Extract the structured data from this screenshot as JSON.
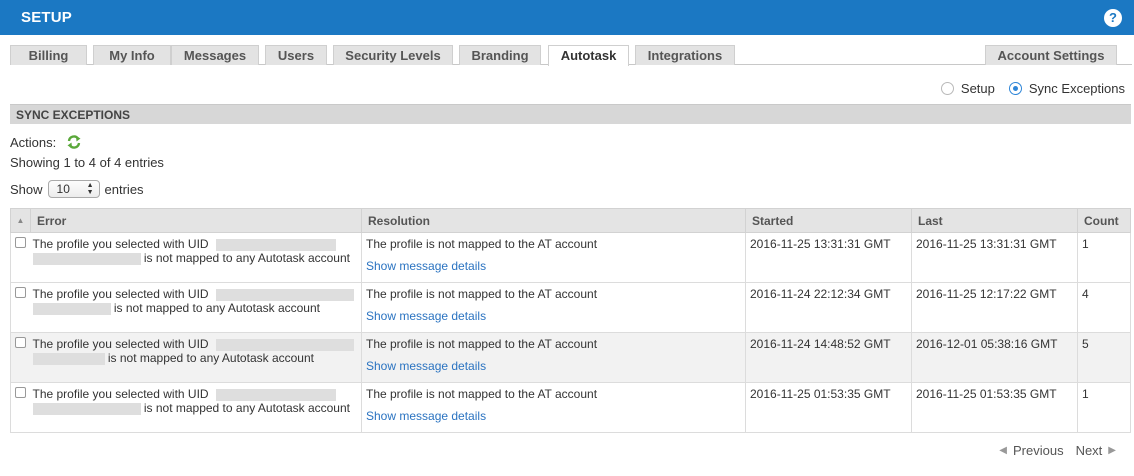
{
  "header": {
    "title": "SETUP",
    "help_glyph": "?"
  },
  "tabs": [
    {
      "label": "Billing"
    },
    {
      "label": "My Info"
    },
    {
      "label": "Messages"
    },
    {
      "label": "Users"
    },
    {
      "label": "Security Levels"
    },
    {
      "label": "Branding"
    },
    {
      "label": "Autotask",
      "active": true
    },
    {
      "label": "Integrations"
    }
  ],
  "account_tab": {
    "label": "Account Settings"
  },
  "view_mode": {
    "options": [
      "Setup",
      "Sync Exceptions"
    ],
    "selected": "Sync Exceptions"
  },
  "section": {
    "title": "SYNC EXCEPTIONS"
  },
  "actions": {
    "label": "Actions:",
    "refresh_icon": "refresh-icon"
  },
  "info": {
    "showing": "Showing 1 to 4 of 4 entries"
  },
  "length": {
    "prefix": "Show",
    "value": "10",
    "suffix": "entries"
  },
  "table": {
    "columns": [
      "Error",
      "Resolution",
      "Started",
      "Last",
      "Count"
    ],
    "rows": [
      {
        "error_line1": "The profile you selected with UID",
        "error_line2": "is not mapped to any Autotask account",
        "resolution": "The profile is not mapped to the AT account",
        "link": "Show message details",
        "started": "2016-11-25 13:31:31 GMT",
        "last": "2016-11-25 13:31:31 GMT",
        "count": "1"
      },
      {
        "error_line1": "The profile you selected with UID",
        "error_line2": "is not mapped to any Autotask account",
        "resolution": "The profile is not mapped to the AT account",
        "link": "Show message details",
        "started": "2016-11-24 22:12:34 GMT",
        "last": "2016-11-25 12:17:22 GMT",
        "count": "4"
      },
      {
        "error_line1": "The profile you selected with UID",
        "error_line2": "is not mapped to any Autotask account",
        "resolution": "The profile is not mapped to the AT account",
        "link": "Show message details",
        "started": "2016-11-24 14:48:52 GMT",
        "last": "2016-12-01 05:38:16 GMT",
        "count": "5"
      },
      {
        "error_line1": "The profile you selected with UID",
        "error_line2": "is not mapped to any Autotask account",
        "resolution": "The profile is not mapped to the AT account",
        "link": "Show message details",
        "started": "2016-11-25 01:53:35 GMT",
        "last": "2016-11-25 01:53:35 GMT",
        "count": "1"
      }
    ]
  },
  "pagination": {
    "previous": "Previous",
    "next": "Next"
  }
}
